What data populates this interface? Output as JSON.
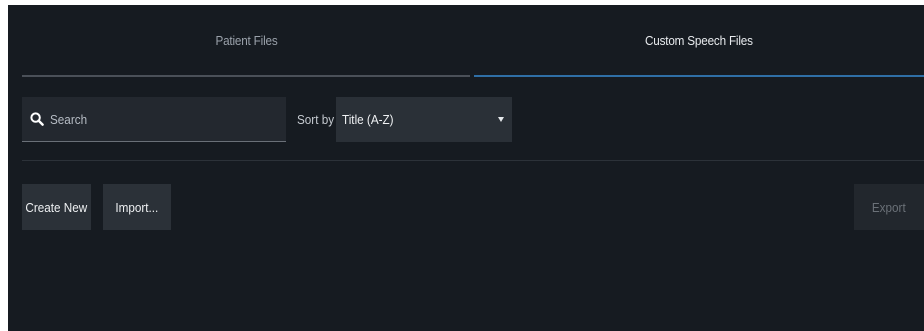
{
  "tabs": {
    "patient_files": "Patient Files",
    "custom_speech_files": "Custom Speech Files",
    "active": "Custom Speech Files"
  },
  "search": {
    "placeholder": "Search"
  },
  "sort": {
    "label": "Sort by",
    "selected": "Title (A-Z)"
  },
  "actions": {
    "create_new": "Create New",
    "import": "Import...",
    "export": "Export"
  },
  "colors": {
    "background": "#161b21",
    "active_tab_underline": "#2f6fa6",
    "button_bg": "#2b3138"
  }
}
